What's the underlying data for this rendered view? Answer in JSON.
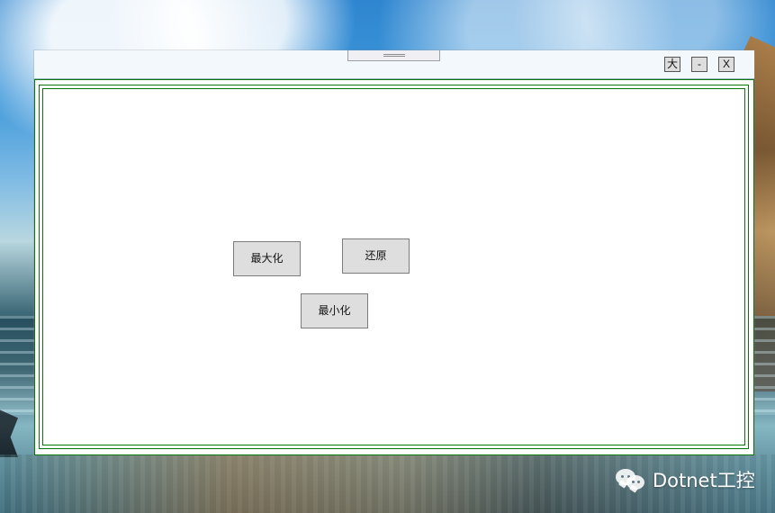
{
  "window": {
    "title_buttons": {
      "maximize_label": "大",
      "minimize_label": "-",
      "close_label": "X"
    },
    "content_buttons": {
      "maximize_label": "最大化",
      "restore_label": "还原",
      "minimize_label": "最小化"
    }
  },
  "watermark": {
    "text": "Dotnet工控"
  },
  "colors": {
    "border_green": "#087608",
    "button_gray": "#dedede",
    "titlebar_bg": "#f3f8fd"
  },
  "icons": {
    "drag_handle": "grip-lines-icon",
    "watermark": "wechat-icon"
  }
}
